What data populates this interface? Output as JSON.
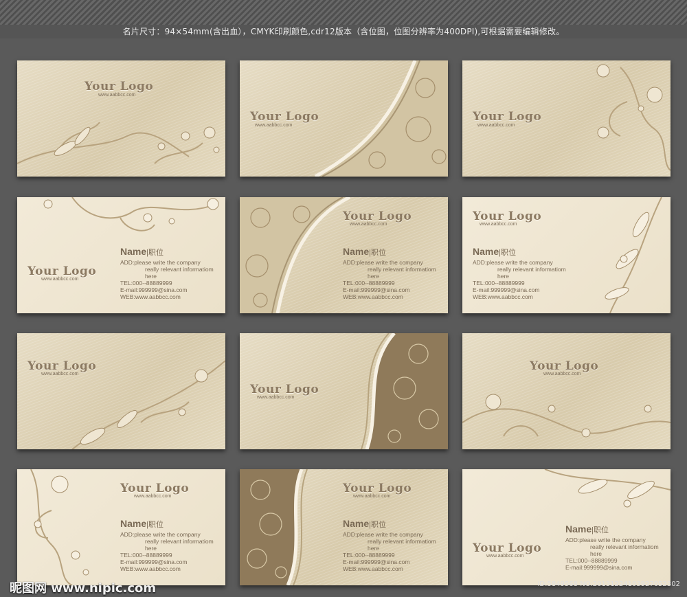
{
  "caption": "名片尺寸：94×54mm(含出血），CMYK印刷颜色,cdr12版本（含位图，位图分辨率为400DPI),可根据需要编辑修改。",
  "logo_text": "Your Logo",
  "url_text": "www.aabbcc.com",
  "name_label": "Name",
  "position_label": "|职位",
  "address_line1": "ADD:please write the company",
  "address_line2": "really relevant informatiom",
  "address_line3": "here",
  "tel": "TEL:000--88889999",
  "email": "E-mail:999999@sina.com",
  "web": "WEB:www.aabbcc.com",
  "watermark_site": "昵图网 www.nipic.com",
  "watermark_id": "ID:5849568 NO:20131224103927052302",
  "colors": {
    "text": "#7a6a55",
    "card_light": "#f2ead8",
    "card_brushed": "#ddd1b4",
    "background": "#5a5a5a"
  }
}
